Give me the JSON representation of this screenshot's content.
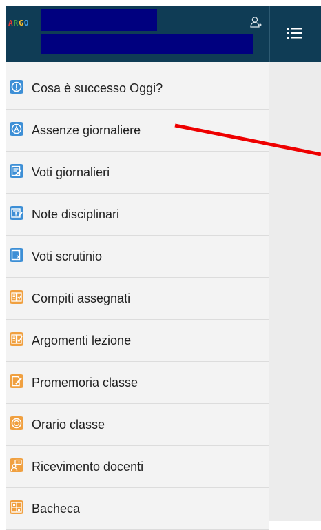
{
  "app": {
    "logo_letters": [
      "A",
      "R",
      "G",
      "O"
    ],
    "logo_colors": [
      "#e53935",
      "#43a047",
      "#fbc02d",
      "#1e88e5"
    ]
  },
  "header": {
    "redacted_color": "#00007f",
    "background_color": "#0f3c55",
    "user_icon": "user-switch-icon"
  },
  "toolbar": {
    "menu_icon": "hamburger-list-icon"
  },
  "menu": {
    "items": [
      {
        "label": "Cosa è successo Oggi?",
        "icon": "info-circle-icon",
        "color": "#3d8fd6"
      },
      {
        "label": "Assenze giornaliere",
        "icon": "absence-circle-icon",
        "color": "#3d8fd6"
      },
      {
        "label": "Voti giornalieri",
        "icon": "daily-grades-icon",
        "color": "#3d8fd6"
      },
      {
        "label": "Note disciplinari",
        "icon": "discipline-notes-icon",
        "color": "#3d8fd6"
      },
      {
        "label": "Voti scrutinio",
        "icon": "final-grades-icon",
        "color": "#3d8fd6"
      },
      {
        "label": "Compiti assegnati",
        "icon": "homework-book-icon",
        "color": "#f0a040"
      },
      {
        "label": "Argomenti lezione",
        "icon": "lesson-topics-icon",
        "color": "#f0a040"
      },
      {
        "label": "Promemoria classe",
        "icon": "class-reminder-icon",
        "color": "#f0a040"
      },
      {
        "label": "Orario classe",
        "icon": "class-schedule-icon",
        "color": "#f0a040"
      },
      {
        "label": "Ricevimento docenti",
        "icon": "teacher-meeting-icon",
        "color": "#f0a040"
      },
      {
        "label": "Bacheca",
        "icon": "bulletin-board-icon",
        "color": "#f0a040"
      }
    ]
  },
  "annotation": {
    "arrow_color": "#ee0000"
  }
}
